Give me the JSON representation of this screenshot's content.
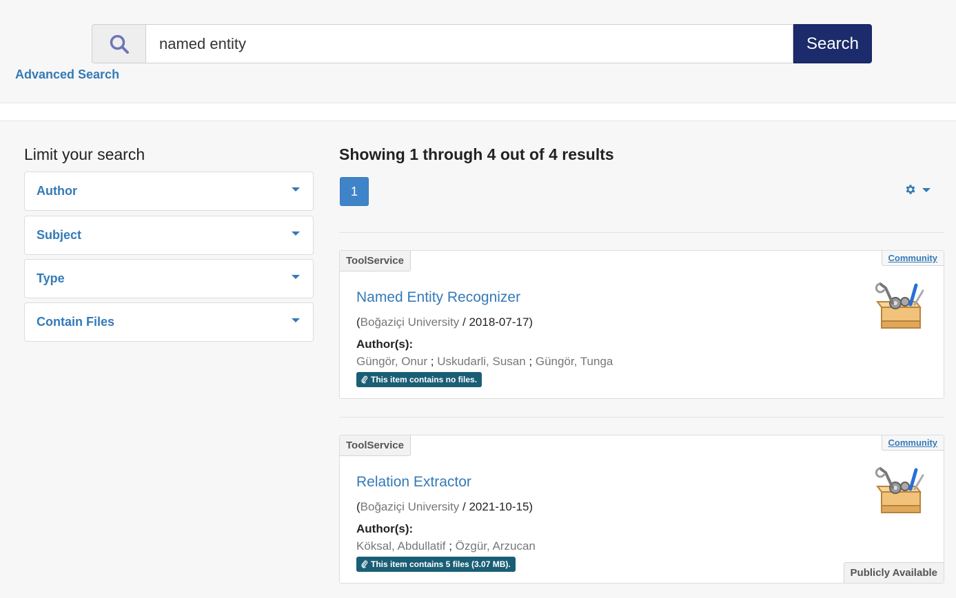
{
  "search": {
    "query": "named entity",
    "button_label": "Search",
    "advanced_label": "Advanced Search",
    "icon": "search-icon"
  },
  "facets": {
    "title": "Limit your search",
    "items": [
      {
        "label": "Author"
      },
      {
        "label": "Subject"
      },
      {
        "label": "Type"
      },
      {
        "label": "Contain Files"
      }
    ]
  },
  "results": {
    "heading": "Showing 1 through 4 out of 4 results",
    "current_page": "1",
    "settings_icon": "gear-icon",
    "items": [
      {
        "type": "ToolService",
        "community": "Community",
        "title": "Named Entity Recognizer",
        "open_paren": "(",
        "publisher": "Boğaziçi University",
        "date_part": " / 2018-07-17)",
        "authors_label": "Author(s):",
        "authors": [
          "Güngör, Onur",
          "Uskudarli, Susan",
          "Güngör, Tunga"
        ],
        "sep": " ; ",
        "files": "This item contains no files.",
        "icon": "toolbox-icon"
      },
      {
        "type": "ToolService",
        "community": "Community",
        "title": "Relation Extractor",
        "open_paren": "(",
        "publisher": "Boğaziçi University",
        "date_part": " / 2021-10-15)",
        "authors_label": "Author(s):",
        "authors": [
          "Köksal, Abdullatif",
          "Özgür, Arzucan"
        ],
        "sep": " ; ",
        "files": "This item contains 5 files (3.07 MB).",
        "availability": "Publicly Available",
        "icon": "toolbox-icon"
      }
    ]
  },
  "colors": {
    "link": "#337ab7",
    "search_button": "#1b2b6b",
    "page_active": "#3f84c9",
    "files_badge": "#1a5e75"
  }
}
